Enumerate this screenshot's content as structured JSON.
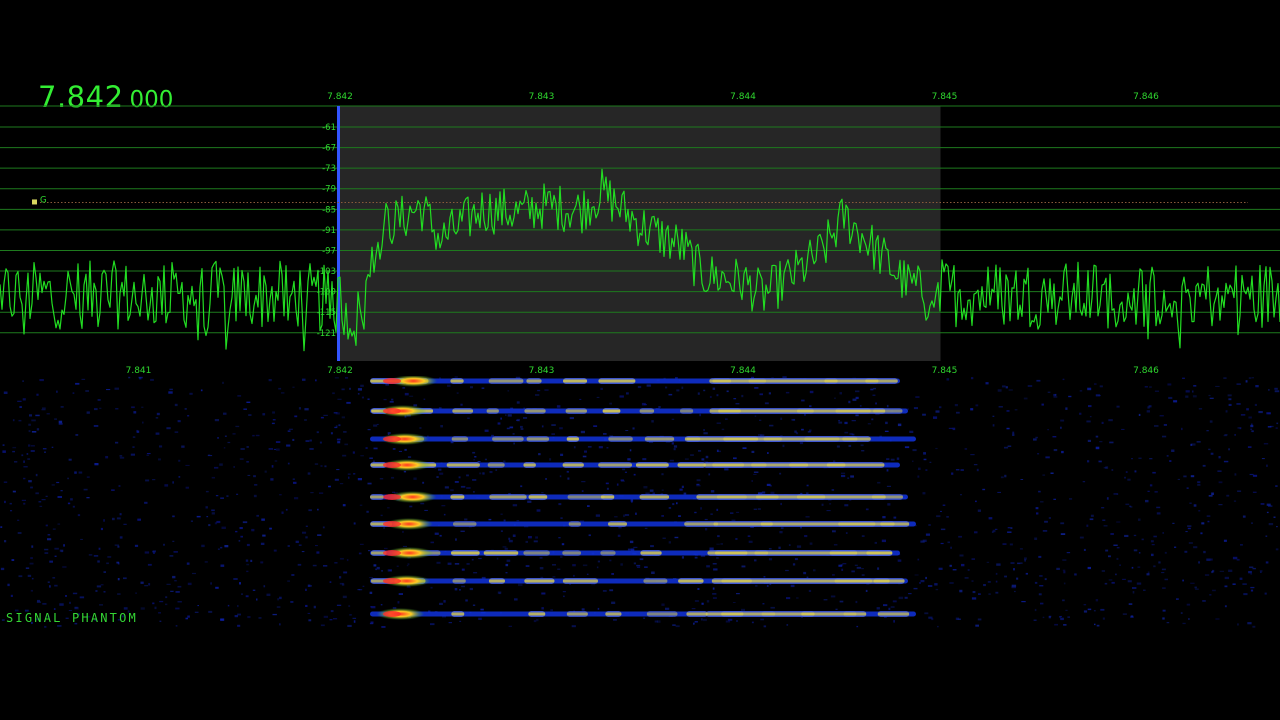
{
  "frequency": {
    "main": "7.842",
    "sub": "000"
  },
  "brand": "SIGNAL PHANTOM",
  "marker": {
    "label": "G",
    "db_level": -83
  },
  "scale": {
    "top_ticks": [
      "7.842",
      "7.843",
      "7.844",
      "7.845",
      "7.846"
    ],
    "bottom_ticks": [
      "7.841",
      "7.842",
      "7.843",
      "7.844",
      "7.845",
      "7.846"
    ],
    "db_levels": [
      "-61",
      "-67",
      "-73",
      "-79",
      "-85",
      "-91",
      "-97",
      "-103",
      "-109",
      "-115",
      "-121"
    ]
  },
  "passband": {
    "low_mhz": 7.842,
    "high_mhz": 7.845
  },
  "colors": {
    "trace": "#22dd22",
    "grid": "#1e7a1e",
    "passband": "#262626",
    "tuning_line": "#3355ff",
    "marker": "#d8d860"
  },
  "chart_data": {
    "type": "line",
    "x_unit": "MHz",
    "y_unit": "dB",
    "xlim": [
      7.8403,
      7.8466
    ],
    "ylim": [
      -125,
      -58
    ],
    "series": [
      {
        "x": [
          7.8403,
          7.841,
          7.8415,
          7.8418,
          7.842,
          7.8421,
          7.8422,
          7.8423,
          7.8424,
          7.8425,
          7.8427,
          7.8429,
          7.843,
          7.8432,
          7.8433,
          7.8435,
          7.8437,
          7.8438,
          7.844,
          7.8441,
          7.8443,
          7.8444,
          7.8445,
          7.8446,
          7.8448,
          7.8449,
          7.8455,
          7.846,
          7.8466
        ],
        "y": [
          -110,
          -110,
          -110,
          -110,
          -112,
          -118,
          -90,
          -88,
          -84,
          -94,
          -85,
          -86,
          -84,
          -85,
          -80,
          -90,
          -96,
          -104,
          -106,
          -110,
          -102,
          -97,
          -87,
          -93,
          -106,
          -109,
          -110,
          -110,
          -110
        ]
      }
    ]
  }
}
